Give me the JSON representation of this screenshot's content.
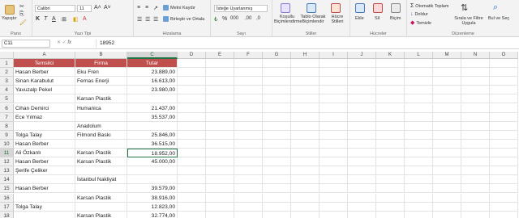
{
  "ribbon": {
    "paste": "Yapıştır",
    "font_name": "Calibri",
    "font_size": "11",
    "wrap_text": "Metni Kaydır",
    "merge_center": "Birleştir ve Ortala",
    "number_format": "İsteğe Uyarlanmış",
    "conditional": "Koşullu Biçimlendirme",
    "table_format": "Tablo Olarak Biçimlendir",
    "cell_styles": "Hücre Stilleri",
    "insert": "Ekle",
    "delete": "Sil",
    "format": "Biçim",
    "autosum": "Otomatik Toplam",
    "fill": "Doldur",
    "clear": "Temizle",
    "sort_filter": "Sırala ve Filtre Uygula",
    "find_select": "Bul ve Seç",
    "groups": [
      "Pano",
      "Yazı Tipi",
      "Hizalama",
      "Sayı",
      "Stiller",
      "Hücreler",
      "Düzenleme"
    ],
    "colors": {
      "accent_green": "#217346",
      "header_fill": "#c0504d"
    }
  },
  "formula_bar": {
    "name_box": "C11",
    "fx": "fx",
    "value": "18952"
  },
  "columns": [
    "A",
    "B",
    "C",
    "D",
    "E",
    "F",
    "G",
    "H",
    "I",
    "J",
    "K",
    "L",
    "M",
    "N",
    "O"
  ],
  "selected_col": "C",
  "selected_row": 11,
  "rows": [
    {
      "n": "1",
      "a": "Temsilci",
      "b": "Firma",
      "c": "Tutar",
      "header": true
    },
    {
      "n": "2",
      "a": "Hasan Berber",
      "b": "Eku Fren",
      "c": "23.889,00"
    },
    {
      "n": "3",
      "a": "Sinan Karabulut",
      "b": "Fernas Enerji",
      "c": "16.613,00"
    },
    {
      "n": "4",
      "a": "Yavuzalp Pekel",
      "b": "",
      "c": "23.980,00"
    },
    {
      "n": "5",
      "a": "",
      "b": "Karsan Plastik",
      "c": ""
    },
    {
      "n": "6",
      "a": "Cihan Demirci",
      "b": "Humanica",
      "c": "21.437,00"
    },
    {
      "n": "7",
      "a": "Ece Yılmaz",
      "b": "",
      "c": "35.537,00"
    },
    {
      "n": "8",
      "a": "",
      "b": "Anadolum",
      "c": ""
    },
    {
      "n": "9",
      "a": "Tolga Talay",
      "b": "Filmond Baskı",
      "c": "25.846,00"
    },
    {
      "n": "10",
      "a": "Hasan Berber",
      "b": "",
      "c": "36.515,00"
    },
    {
      "n": "11",
      "a": "Ali Özkanlı",
      "b": "Karsan Plastik",
      "c": "18.952,00"
    },
    {
      "n": "12",
      "a": "Hasan Berber",
      "b": "Karsan Plastik",
      "c": "45.000,00"
    },
    {
      "n": "13",
      "a": "Şerife Çeliker",
      "b": "",
      "c": ""
    },
    {
      "n": "14",
      "a": "",
      "b": "İstanbul Nakliyat",
      "c": ""
    },
    {
      "n": "15",
      "a": "Hasan Berber",
      "b": "",
      "c": "39.579,00"
    },
    {
      "n": "16",
      "a": "",
      "b": "Karsan Plastik",
      "c": "38.916,00"
    },
    {
      "n": "17",
      "a": "Tolga Talay",
      "b": "",
      "c": "12.823,00"
    },
    {
      "n": "18",
      "a": "",
      "b": "Karsan Plastik",
      "c": "32.774,00"
    }
  ]
}
